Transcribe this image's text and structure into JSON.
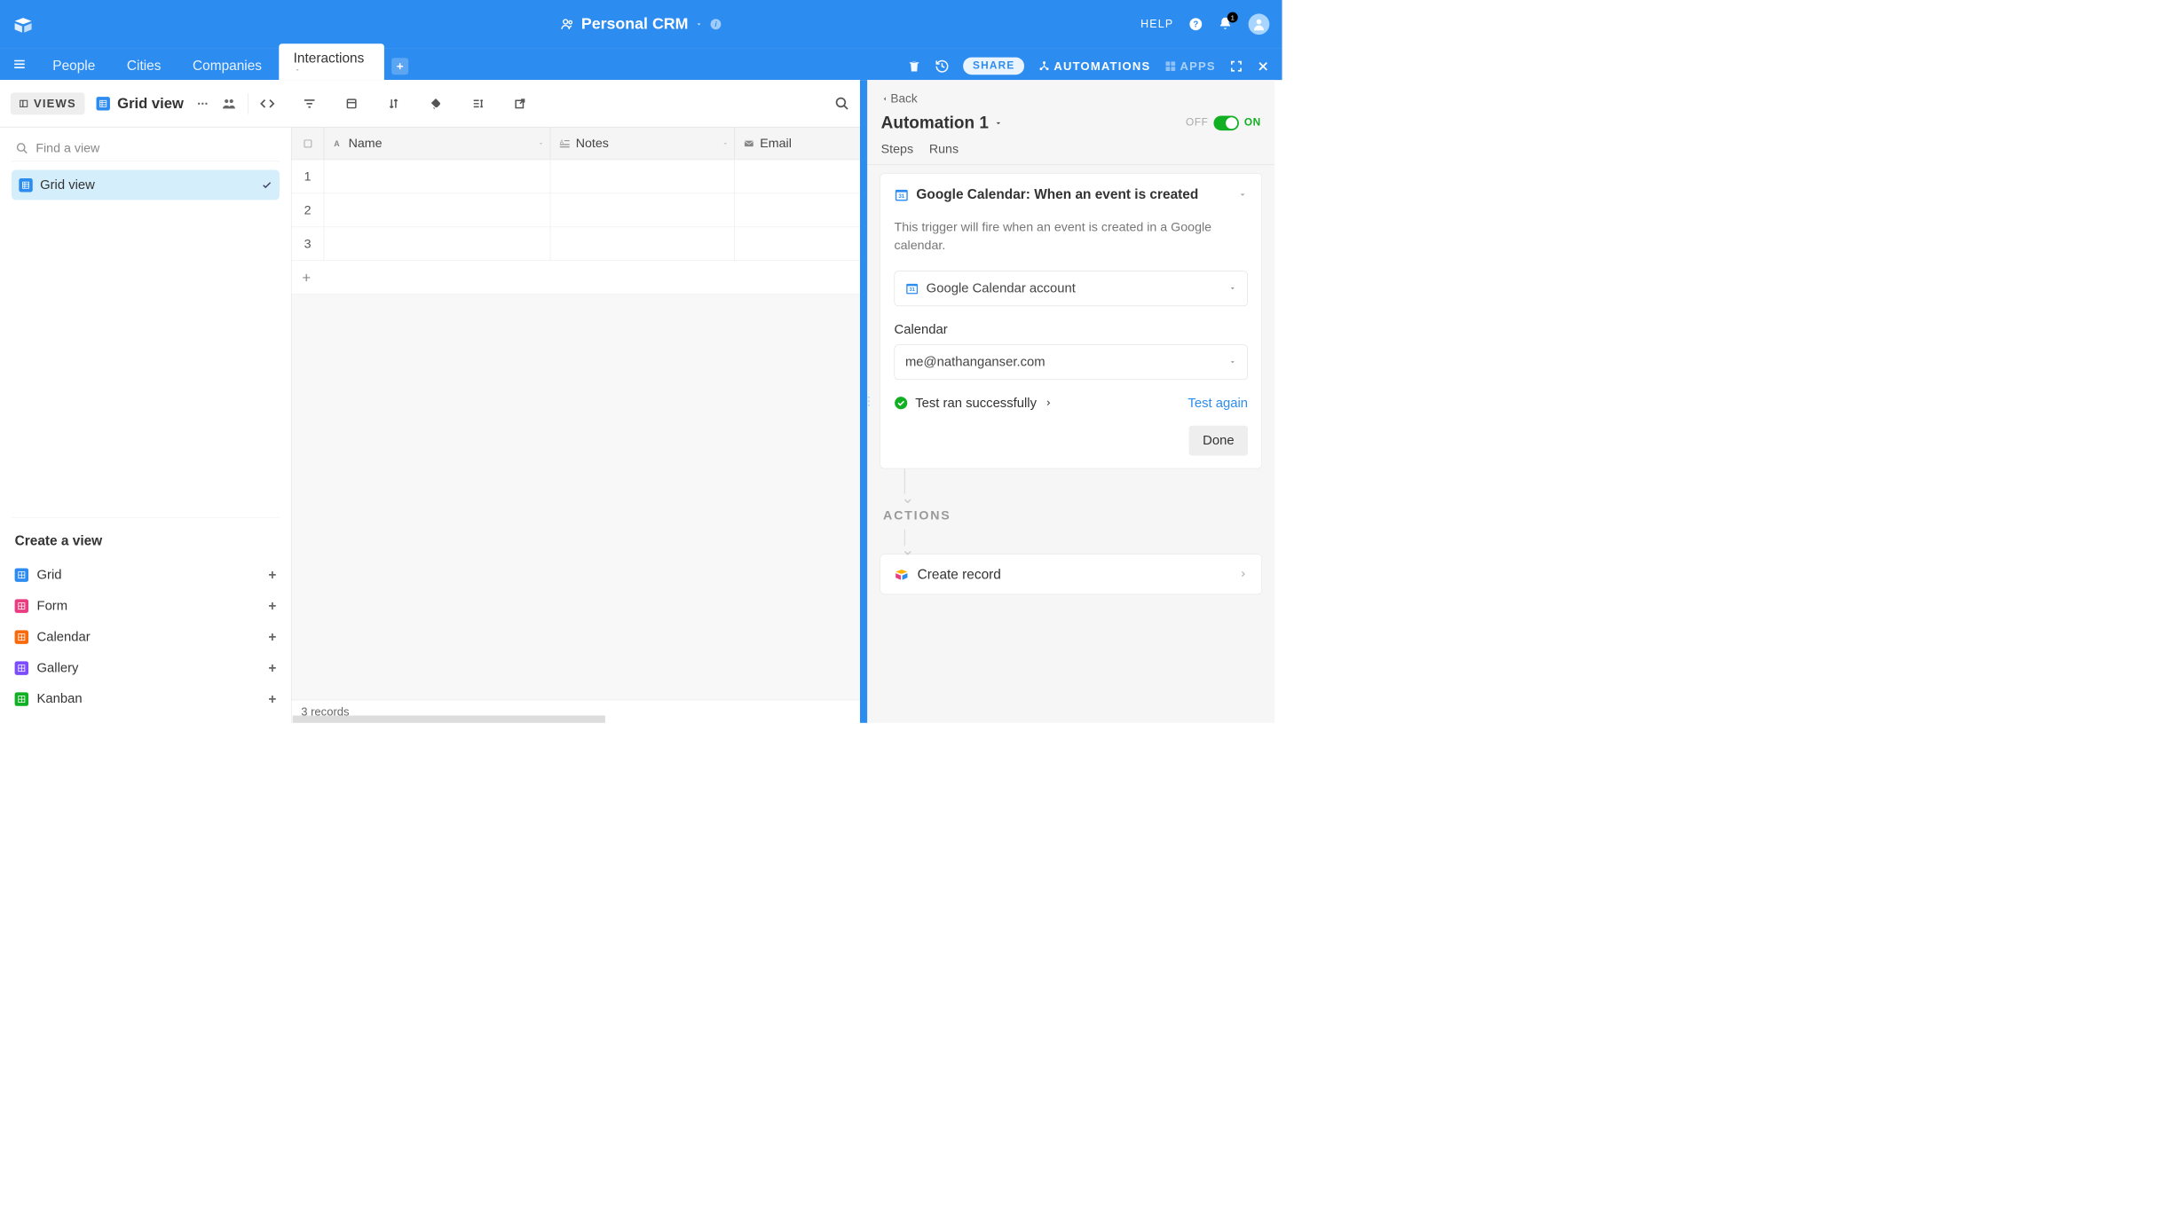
{
  "header": {
    "app_title": "Personal CRM",
    "help_label": "HELP",
    "notification_count": "1"
  },
  "tabs": {
    "items": [
      "People",
      "Cities",
      "Companies",
      "Interactions"
    ],
    "active_index": 3,
    "share_label": "SHARE",
    "automations_label": "AUTOMATIONS",
    "apps_label": "APPS"
  },
  "toolbar": {
    "views_label": "VIEWS",
    "view_name": "Grid view"
  },
  "sidebar": {
    "find_placeholder": "Find a view",
    "views": [
      {
        "label": "Grid view",
        "selected": true
      }
    ],
    "create_title": "Create a view",
    "options": [
      {
        "label": "Grid",
        "color": "blue-bg"
      },
      {
        "label": "Form",
        "color": "pink-bg"
      },
      {
        "label": "Calendar",
        "color": "orange-bg"
      },
      {
        "label": "Gallery",
        "color": "purple-bg"
      },
      {
        "label": "Kanban",
        "color": "green-bg"
      }
    ]
  },
  "grid": {
    "columns": [
      "Name",
      "Notes",
      "Email"
    ],
    "rows": [
      "1",
      "2",
      "3"
    ],
    "footer": "3 records"
  },
  "automation": {
    "back_label": "Back",
    "title": "Automation 1",
    "off_label": "OFF",
    "on_label": "ON",
    "tabs": [
      "Steps",
      "Runs"
    ],
    "trigger": {
      "title": "Google Calendar: When an event is created",
      "description": "This trigger will fire when an event is created in a Google calendar.",
      "account_label": "Google Calendar account",
      "calendar_label": "Calendar",
      "calendar_value": "me@nathanganser.com",
      "test_status": "Test ran successfully",
      "test_again": "Test again",
      "done_label": "Done"
    },
    "actions_label": "ACTIONS",
    "action": {
      "label": "Create record"
    }
  }
}
